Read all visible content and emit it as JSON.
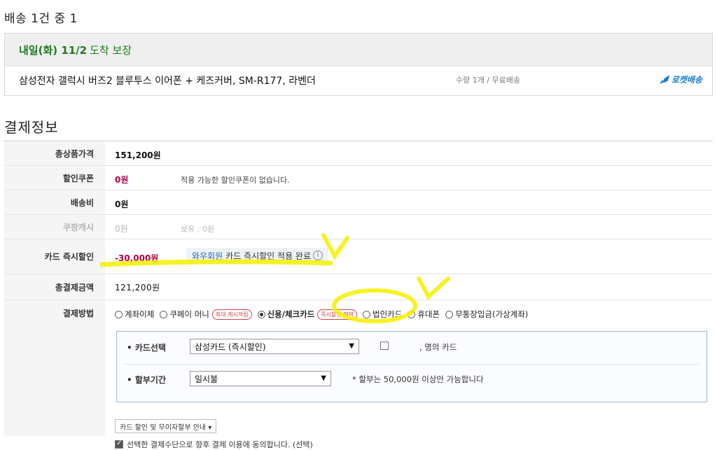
{
  "shipment": {
    "title": "배송 1건 중 1",
    "arrival_strong": "내일(화) 11/2",
    "arrival_rest": "도착 보장",
    "product_name": "삼성전자 갤럭시 버즈2 블루투스 이어폰 + 케즈커버, SM-R177, 라벤더",
    "qty_shipping": "수량 1개 / 무료배송",
    "rocket_label": "로켓배송",
    "rocket_icon": "rocket-icon"
  },
  "payment": {
    "title": "결제정보",
    "rows": {
      "total_product": {
        "label": "총상품가격",
        "value": "151,200원"
      },
      "coupon": {
        "label": "할인쿠폰",
        "value": "0원",
        "note": "적용 가능한 할인쿠폰이 없습니다."
      },
      "shipping_fee": {
        "label": "배송비",
        "value": "0원"
      },
      "coupang_cash": {
        "label": "쿠팡캐시",
        "value": "0원",
        "note": "보유 : 0원"
      },
      "card_discount": {
        "label": "카드 즉시할인",
        "value": "-30,000원",
        "wow": "와우회원",
        "note": "카드 즉시할인 적용 완료"
      },
      "total_payment": {
        "label": "총결제금액",
        "value": "121,200원"
      },
      "method": {
        "label": "결제방법"
      }
    },
    "methods": [
      {
        "label": "계좌이체",
        "tag": "",
        "selected": false
      },
      {
        "label": "쿠페이 머니",
        "tag": "최대 캐시적립",
        "selected": false
      },
      {
        "label": "신용/체크카드",
        "tag": "즉시할인 혜택",
        "selected": true
      },
      {
        "label": "법인카드",
        "tag": "",
        "selected": false
      },
      {
        "label": "휴대폰",
        "tag": "",
        "selected": false
      },
      {
        "label": "무통장입금(가상계좌)",
        "tag": "",
        "selected": false
      }
    ],
    "card_select": {
      "label": "• 카드선택",
      "value": "삼성카드 (즉시할인)",
      "other_card": ", 명의 카드"
    },
    "installment": {
      "label": "• 할부기간",
      "value": "일시불",
      "note": "* 할부는 50,000원 이상만 가능합니다"
    },
    "guide_button": "카드 할인 및 무이자할부 안내 ▾",
    "consent": "선택한 결제수단으로 향후 결제 이용에 동의합니다. (선택)"
  },
  "colors": {
    "accent_green": "#1f7a1f",
    "discount_red": "#b0004a",
    "rocket_blue": "#1a7bd6",
    "highlight_yellow": "#f5f000"
  }
}
